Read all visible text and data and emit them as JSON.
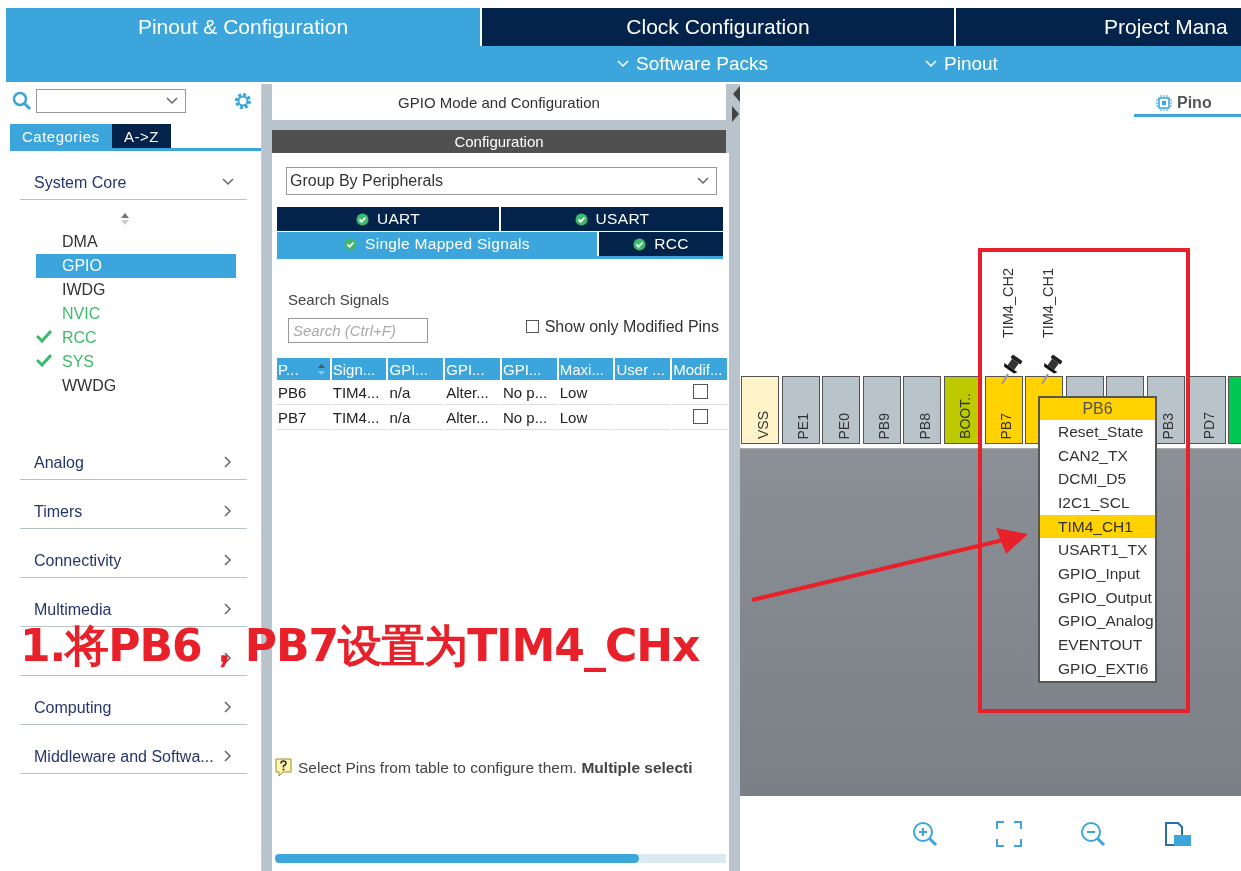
{
  "main_tabs": [
    {
      "label": "Pinout & Configuration",
      "selected": true
    },
    {
      "label": "Clock Configuration",
      "selected": false
    },
    {
      "label": "Project Mana",
      "selected": false
    }
  ],
  "sub_menus": [
    "Software Packs",
    "Pinout"
  ],
  "sidebar": {
    "tabs": [
      {
        "label": "Categories",
        "selected": true
      },
      {
        "label": "A->Z",
        "selected": false
      }
    ],
    "categories": [
      {
        "label": "System Core",
        "expanded": true,
        "items": [
          {
            "label": "DMA",
            "selected": false,
            "enabled": false,
            "checked": false
          },
          {
            "label": "GPIO",
            "selected": true,
            "enabled": false,
            "checked": false
          },
          {
            "label": "IWDG",
            "selected": false,
            "enabled": false,
            "checked": false
          },
          {
            "label": "NVIC",
            "selected": false,
            "enabled": true,
            "checked": false
          },
          {
            "label": "RCC",
            "selected": false,
            "enabled": true,
            "checked": true
          },
          {
            "label": "SYS",
            "selected": false,
            "enabled": true,
            "checked": true
          },
          {
            "label": "WWDG",
            "selected": false,
            "enabled": false,
            "checked": false
          }
        ]
      },
      {
        "label": "Analog",
        "expanded": false
      },
      {
        "label": "Timers",
        "expanded": false
      },
      {
        "label": "Connectivity",
        "expanded": false
      },
      {
        "label": "Multimedia",
        "expanded": false
      },
      {
        "expanded": false
      },
      {
        "label": "Computing",
        "expanded": false
      },
      {
        "label": "Middleware and Softwa...",
        "expanded": false
      }
    ]
  },
  "config_panel": {
    "title": "GPIO Mode and Configuration",
    "header": "Configuration",
    "group_by": "Group By Peripherals",
    "tab_rows": [
      [
        {
          "label": "UART",
          "selected": false
        },
        {
          "label": "USART",
          "selected": false
        }
      ],
      [
        {
          "label": "Single Mapped Signals",
          "selected": true
        },
        {
          "label": "RCC",
          "selected": false
        }
      ]
    ],
    "search_label": "Search Signals",
    "search_placeholder": "Search (Ctrl+F)",
    "modified_only": {
      "label": "Show only Modified Pins",
      "checked": false
    },
    "table": {
      "columns": [
        "P...",
        "Sign...",
        "GPI...",
        "GPI...",
        "GPI...",
        "Maxi...",
        "User ...",
        "Modif..."
      ],
      "rows": [
        {
          "cells": [
            "PB6",
            "TIM4...",
            "n/a",
            "Alter...",
            "No p...",
            "Low"
          ],
          "modified": false
        },
        {
          "cells": [
            "PB7",
            "TIM4...",
            "n/a",
            "Alter...",
            "No p...",
            "Low"
          ],
          "modified": false
        }
      ]
    },
    "hint": "Select Pins from table to configure them. **Multiple selecti**"
  },
  "pinout": {
    "view_tab": "Pino",
    "pins": [
      {
        "label": "VSS",
        "color": "#fff4c9"
      },
      {
        "label": "PE1",
        "color": "#b9c3ca"
      },
      {
        "label": "PE0",
        "color": "#b9c3ca"
      },
      {
        "label": "PB9",
        "color": "#b9c3ca"
      },
      {
        "label": "PB8",
        "color": "#b9c3ca"
      },
      {
        "label": "BOOT..",
        "color": "#bdca00"
      },
      {
        "label": "PB7",
        "color": "#ffd200"
      },
      {
        "color": "#ffd200"
      },
      {
        "color": "#b9c3ca"
      },
      {
        "color": "#b9c3ca"
      },
      {
        "label": "PB3",
        "color": "#b9c3ca"
      },
      {
        "label": "PD7",
        "color": "#b9c3ca"
      },
      {
        "color": "#00c853"
      }
    ],
    "signals": [
      {
        "label": "TIM4_CH2"
      },
      {
        "label": "TIM4_CH1"
      }
    ],
    "popup": {
      "title": "PB6",
      "items": [
        {
          "label": "Reset_State",
          "selected": false
        },
        {
          "label": "CAN2_TX",
          "selected": false
        },
        {
          "label": "DCMI_D5",
          "selected": false
        },
        {
          "label": "I2C1_SCL",
          "selected": false
        },
        {
          "label": "TIM4_CH1",
          "selected": true
        },
        {
          "label": "USART1_TX",
          "selected": false
        },
        {
          "label": "GPIO_Input",
          "selected": false
        },
        {
          "label": "GPIO_Output",
          "selected": false
        },
        {
          "label": "GPIO_Analog",
          "selected": false
        },
        {
          "label": "EVENTOUT",
          "selected": false
        },
        {
          "label": "GPIO_EXTI6",
          "selected": false
        }
      ]
    }
  },
  "annotation": {
    "text": "1.将PB6，PB7设置为TIM4_CHx"
  }
}
